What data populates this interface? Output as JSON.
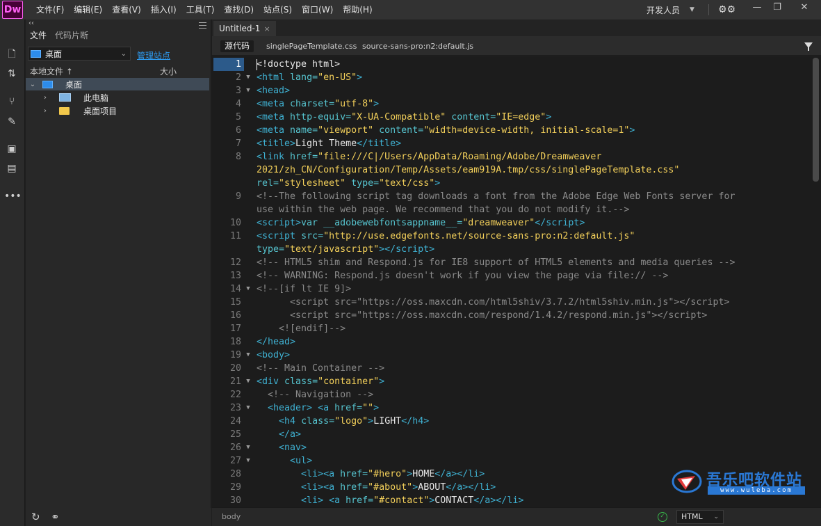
{
  "app": {
    "logo_text": "Dw"
  },
  "menu": [
    "文件(F)",
    "编辑(E)",
    "查看(V)",
    "插入(I)",
    "工具(T)",
    "查找(D)",
    "站点(S)",
    "窗口(W)",
    "帮助(H)"
  ],
  "workspace": {
    "label": "开发人员"
  },
  "files_panel": {
    "tabs": [
      "文件",
      "代码片断"
    ],
    "site_select": "桌面",
    "manage_link": "管理站点",
    "column_local": "本地文件",
    "column_size": "大小",
    "tree": [
      {
        "label": "桌面",
        "icon": "desktop-icon"
      },
      {
        "label": "此电脑",
        "icon": "computer-icon"
      },
      {
        "label": "桌面项目",
        "icon": "folder-icon"
      }
    ]
  },
  "document": {
    "tab_title": "Untitled-1",
    "related_files": [
      "源代码",
      "singlePageTemplate.css",
      "source-sans-pro:n2:default.js"
    ]
  },
  "code": {
    "current_line": 1,
    "lines": [
      {
        "n": "1",
        "fold": "",
        "html": "<span class=\"w\">&lt;!doctype html&gt;</span>"
      },
      {
        "n": "2",
        "fold": "▼",
        "html": "<span class=\"t\">&lt;html</span> <span class=\"a\">lang=</span><span class=\"s\">\"en-US\"</span><span class=\"t\">&gt;</span>"
      },
      {
        "n": "3",
        "fold": "▼",
        "html": "<span class=\"t\">&lt;head&gt;</span>"
      },
      {
        "n": "4",
        "fold": "",
        "html": "<span class=\"t\">&lt;meta</span> <span class=\"a\">charset=</span><span class=\"s\">\"utf-8\"</span><span class=\"t\">&gt;</span>"
      },
      {
        "n": "5",
        "fold": "",
        "html": "<span class=\"t\">&lt;meta</span> <span class=\"a\">http-equiv=</span><span class=\"s\">\"X-UA-Compatible\"</span> <span class=\"a\">content=</span><span class=\"s\">\"IE=edge\"</span><span class=\"t\">&gt;</span>"
      },
      {
        "n": "6",
        "fold": "",
        "html": "<span class=\"t\">&lt;meta</span> <span class=\"a\">name=</span><span class=\"s\">\"viewport\"</span> <span class=\"a\">content=</span><span class=\"s\">\"width=device-width, initial-scale=1\"</span><span class=\"t\">&gt;</span>"
      },
      {
        "n": "7",
        "fold": "",
        "html": "<span class=\"t\">&lt;title&gt;</span><span class=\"w\">Light Theme</span><span class=\"t\">&lt;/title&gt;</span>"
      },
      {
        "n": "8",
        "fold": "",
        "html": "<span class=\"t\">&lt;link</span> <span class=\"a\">href=</span><span class=\"s\">\"file:///C|/Users/AppData/Roaming/Adobe/Dreamweaver</span>"
      },
      {
        "n": "",
        "fold": "",
        "html": "<span class=\"s\">2021/zh_CN/Configuration/Temp/Assets/eam919A.tmp/css/singlePageTemplate.css\"</span>"
      },
      {
        "n": "",
        "fold": "",
        "html": "<span class=\"a\">rel=</span><span class=\"s\">\"stylesheet\"</span> <span class=\"a\">type=</span><span class=\"s\">\"text/css\"</span><span class=\"t\">&gt;</span>"
      },
      {
        "n": "9",
        "fold": "",
        "html": "<span class=\"c\">&lt;!--The following script tag downloads a font from the Adobe Edge Web Fonts server for</span>"
      },
      {
        "n": "",
        "fold": "",
        "html": "<span class=\"c\">use within the web page. We recommend that you do not modify it.--&gt;</span>"
      },
      {
        "n": "10",
        "fold": "",
        "html": "<span class=\"t\">&lt;script&gt;</span><span class=\"a\">var __adobewebfontsappname__=</span><span class=\"s\">\"dreamweaver\"</span><span class=\"t\">&lt;/script&gt;</span>"
      },
      {
        "n": "11",
        "fold": "",
        "html": "<span class=\"t\">&lt;script</span> <span class=\"a\">src=</span><span class=\"s\">\"http://use.edgefonts.net/source-sans-pro:n2:default.js\"</span>"
      },
      {
        "n": "",
        "fold": "",
        "html": "<span class=\"a\">type=</span><span class=\"s\">\"text/javascript\"</span><span class=\"t\">&gt;&lt;/script&gt;</span>"
      },
      {
        "n": "12",
        "fold": "",
        "html": "<span class=\"c\">&lt;!-- HTML5 shim and Respond.js for IE8 support of HTML5 elements and media queries --&gt;</span>"
      },
      {
        "n": "13",
        "fold": "",
        "html": "<span class=\"c\">&lt;!-- WARNING: Respond.js doesn't work if you view the page via file:// --&gt;</span>"
      },
      {
        "n": "14",
        "fold": "▼",
        "html": "<span class=\"c\">&lt;!--[if lt IE 9]&gt;</span>"
      },
      {
        "n": "15",
        "fold": "",
        "html": "<span class=\"c\">      &lt;script src=\"https://oss.maxcdn.com/html5shiv/3.7.2/html5shiv.min.js\"&gt;&lt;/script&gt;</span>"
      },
      {
        "n": "16",
        "fold": "",
        "html": "<span class=\"c\">      &lt;script src=\"https://oss.maxcdn.com/respond/1.4.2/respond.min.js\"&gt;&lt;/script&gt;</span>"
      },
      {
        "n": "17",
        "fold": "",
        "html": "<span class=\"c\">    &lt;![endif]--&gt;</span>"
      },
      {
        "n": "18",
        "fold": "",
        "html": "<span class=\"t\">&lt;/head&gt;</span>"
      },
      {
        "n": "19",
        "fold": "▼",
        "html": "<span class=\"t\">&lt;body&gt;</span>"
      },
      {
        "n": "20",
        "fold": "",
        "html": "<span class=\"c\">&lt;!-- Main Container --&gt;</span>"
      },
      {
        "n": "21",
        "fold": "▼",
        "html": "<span class=\"t\">&lt;div</span> <span class=\"a\">class=</span><span class=\"s\">\"container\"</span><span class=\"t\">&gt;</span>"
      },
      {
        "n": "22",
        "fold": "",
        "html": "<span class=\"c\">  &lt;!-- Navigation --&gt;</span>"
      },
      {
        "n": "23",
        "fold": "▼",
        "html": "  <span class=\"t\">&lt;header&gt;</span> <span class=\"t\">&lt;a</span> <span class=\"a\">href=</span><span class=\"s\">\"\"</span><span class=\"t\">&gt;</span>"
      },
      {
        "n": "24",
        "fold": "",
        "html": "    <span class=\"t\">&lt;h4</span> <span class=\"a\">class=</span><span class=\"s\">\"logo\"</span><span class=\"t\">&gt;</span><span class=\"w\">LIGHT</span><span class=\"t\">&lt;/h4&gt;</span>"
      },
      {
        "n": "25",
        "fold": "",
        "html": "    <span class=\"t\">&lt;/a&gt;</span>"
      },
      {
        "n": "26",
        "fold": "▼",
        "html": "    <span class=\"t\">&lt;nav&gt;</span>"
      },
      {
        "n": "27",
        "fold": "▼",
        "html": "      <span class=\"t\">&lt;ul&gt;</span>"
      },
      {
        "n": "28",
        "fold": "",
        "html": "        <span class=\"t\">&lt;li&gt;&lt;a</span> <span class=\"a\">href=</span><span class=\"s\">\"#hero\"</span><span class=\"t\">&gt;</span><span class=\"w\">HOME</span><span class=\"t\">&lt;/a&gt;&lt;/li&gt;</span>"
      },
      {
        "n": "29",
        "fold": "",
        "html": "        <span class=\"t\">&lt;li&gt;&lt;a</span> <span class=\"a\">href=</span><span class=\"s\">\"#about\"</span><span class=\"t\">&gt;</span><span class=\"w\">ABOUT</span><span class=\"t\">&lt;/a&gt;&lt;/li&gt;</span>"
      },
      {
        "n": "30",
        "fold": "",
        "html": "        <span class=\"t\">&lt;li&gt;</span> <span class=\"t\">&lt;a</span> <span class=\"a\">href=</span><span class=\"s\">\"#contact\"</span><span class=\"t\">&gt;</span><span class=\"w\">CONTACT</span><span class=\"t\">&lt;/a&gt;&lt;/li&gt;</span>"
      }
    ]
  },
  "status": {
    "tag": "body",
    "language": "HTML"
  },
  "watermark": {
    "title": "吾乐吧软件站",
    "url": "www.wuleba.com"
  },
  "colors": {
    "accent": "#2d9cf2",
    "brand": "#ff61f6",
    "tag": "#3fb1d2",
    "string": "#f2cf5a",
    "comment": "#8a8a8a",
    "ok": "#38b54a"
  },
  "icons": [
    "file-icon",
    "sort-icon",
    "git-icon",
    "inspect-icon",
    "comment-icon",
    "checklist-icon",
    "more-icon",
    "refresh-icon",
    "connect-icon",
    "sync-icon",
    "filter-icon",
    "check-icon"
  ]
}
